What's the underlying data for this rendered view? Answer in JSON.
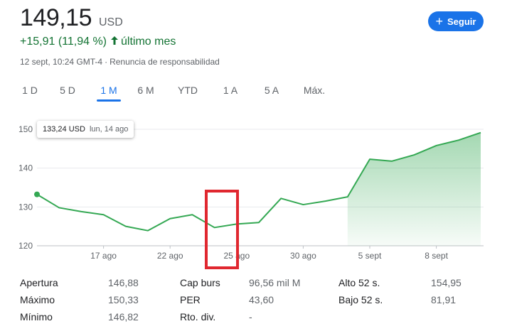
{
  "quote": {
    "price": "149,15",
    "currency": "USD",
    "change": "+15,91 (11,94 %)",
    "change_period": "último mes",
    "timestamp": "12 sept, 10:24 GMT-4",
    "meta_separator": "·",
    "disclaimer": "Renuncia de responsabilidad"
  },
  "follow_button": {
    "label": "Seguir"
  },
  "range_tabs": [
    {
      "label": "1 D",
      "active": false
    },
    {
      "label": "5 D",
      "active": false
    },
    {
      "label": "1 M",
      "active": true
    },
    {
      "label": "6 M",
      "active": false
    },
    {
      "label": "YTD",
      "active": false
    },
    {
      "label": "1 A",
      "active": false
    },
    {
      "label": "5 A",
      "active": false
    },
    {
      "label": "Máx.",
      "active": false
    }
  ],
  "tooltip": {
    "price": "133,24 USD",
    "date": "lun, 14 ago"
  },
  "colors": {
    "line": "#34a853",
    "accent": "#1a73e8",
    "positive": "#137333",
    "highlight": "#e0272f"
  },
  "chart_data": {
    "type": "area",
    "x": [
      "14 ago",
      "15 ago",
      "16 ago",
      "17 ago",
      "18 ago",
      "21 ago",
      "22 ago",
      "23 ago",
      "24 ago",
      "25 ago",
      "28 ago",
      "29 ago",
      "30 ago",
      "31 ago",
      "1 sept",
      "5 sept",
      "6 sept",
      "7 sept",
      "8 sept",
      "11 sept",
      "12 sept"
    ],
    "values": [
      133.24,
      129.8,
      128.8,
      128.0,
      125.0,
      123.9,
      127.0,
      128.0,
      124.7,
      125.6,
      126.0,
      132.2,
      130.6,
      131.5,
      132.6,
      142.3,
      141.8,
      143.4,
      145.8,
      147.2,
      149.15
    ],
    "y_ticks": [
      "150",
      "140",
      "130",
      "120"
    ],
    "y_tick_values": [
      150,
      140,
      130,
      120
    ],
    "x_ticks": [
      {
        "label": "17 ago",
        "index": 3
      },
      {
        "label": "22 ago",
        "index": 6
      },
      {
        "label": "25 ago",
        "index": 9
      },
      {
        "label": "30 ago",
        "index": 12
      },
      {
        "label": "5 sept",
        "index": 15
      },
      {
        "label": "8 sept",
        "index": 18
      }
    ],
    "ylim": [
      120,
      150
    ],
    "shaded_from_index": 14,
    "grid": true
  },
  "stats": [
    {
      "label": "Apertura",
      "value": "146,88"
    },
    {
      "label": "Máximo",
      "value": "150,33"
    },
    {
      "label": "Mínimo",
      "value": "146,82"
    },
    {
      "label": "Cap burs",
      "value": "96,56 mil M"
    },
    {
      "label": "PER",
      "value": "43,60"
    },
    {
      "label": "Rto. div.",
      "value": "-"
    },
    {
      "label": "Alto 52 s.",
      "value": "154,95"
    },
    {
      "label": "Bajo 52 s.",
      "value": "81,91"
    }
  ]
}
